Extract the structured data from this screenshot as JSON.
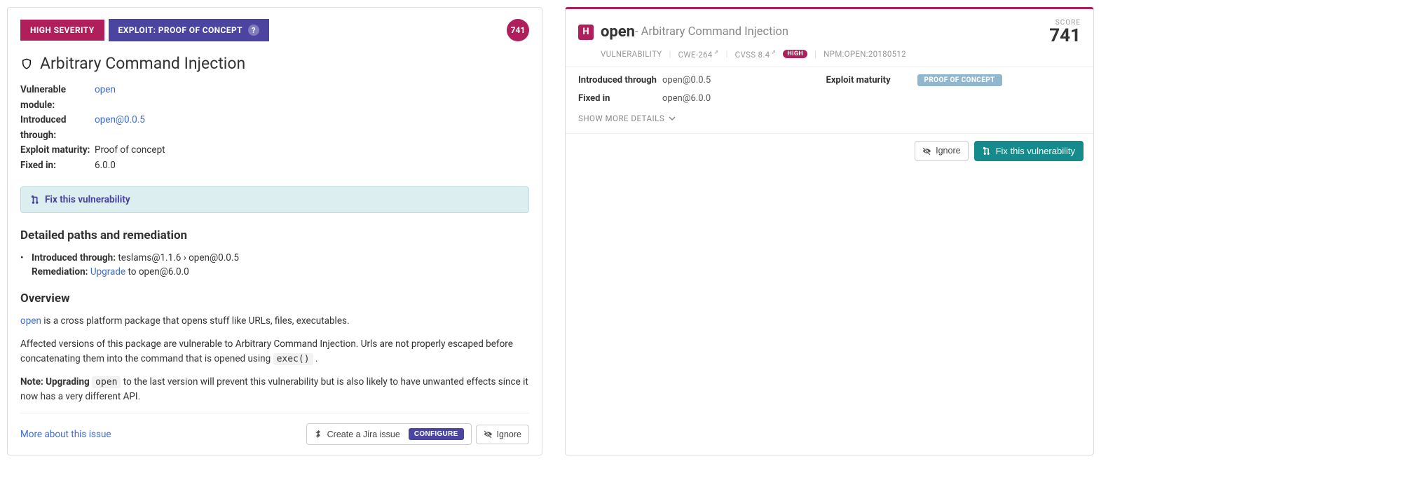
{
  "left": {
    "badges": {
      "severity": "HIGH SEVERITY",
      "exploit": "EXPLOIT: PROOF OF CONCEPT"
    },
    "score": "741",
    "title": "Arbitrary Command Injection",
    "meta": {
      "module_label": "Vulnerable module:",
      "module": "open",
      "introduced_label": "Introduced through:",
      "introduced": "open@0.0.5",
      "maturity_label": "Exploit maturity:",
      "maturity": "Proof of concept",
      "fixed_label": "Fixed in:",
      "fixed": "6.0.0"
    },
    "fix_banner": "Fix this vulnerability",
    "paths_heading": "Detailed paths and remediation",
    "paths": {
      "intro_label": "Introduced through:",
      "intro_val": "teslams@1.1.6 › open@0.0.5",
      "rem_label": "Remediation:",
      "rem_action": "Upgrade",
      "rem_target": " to open@6.0.0"
    },
    "overview_heading": "Overview",
    "overview": {
      "pkg": "open",
      "desc": " is a cross platform package that opens stuff like URLs, files, executables.",
      "affected": "Affected versions of this package are vulnerable to Arbitrary Command Injection. Urls are not properly escaped before concatenating them into the command that is opened using ",
      "exec_code": "exec()",
      "affected_end": " .",
      "note_label": "Note: Upgrading ",
      "note_pkg": "open",
      "note_rest": " to the last version will prevent this vulnerability but is also likely to have unwanted effects since it now has a very different API."
    },
    "more_link": "More about this issue",
    "actions": {
      "jira": "Create a Jira issue",
      "configure": "CONFIGURE",
      "ignore": "Ignore"
    }
  },
  "right": {
    "sev_letter": "H",
    "name": "open",
    "subtitle": " - Arbitrary Command Injection",
    "score_label": "SCORE",
    "score": "741",
    "meta": {
      "vuln_tag": "VULNERABILITY",
      "cwe": "CWE-264",
      "cvss": "CVSS 8.4",
      "high": "HIGH",
      "npm": "NPM:OPEN:20180512"
    },
    "details": {
      "intro_label": "Introduced through",
      "intro_val": "open@0.0.5",
      "fixed_label": "Fixed in",
      "fixed_val": "open@6.0.0",
      "maturity_label": "Exploit maturity",
      "maturity_val": "PROOF OF CONCEPT"
    },
    "show_more": "Show more details",
    "actions": {
      "ignore": "Ignore",
      "fix": "Fix this vulnerability"
    }
  }
}
